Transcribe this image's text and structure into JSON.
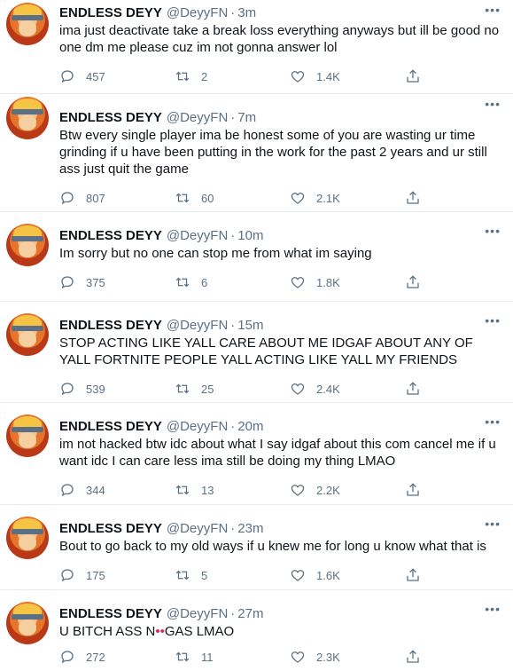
{
  "tweets": [
    {
      "name": "ENDLESS DEYY",
      "handle": "@DeyyFN",
      "time": "3m",
      "text": "ima just deactivate take a break loss everything anyways but ill be good no one dm me please cuz im not gonna answer lol",
      "replies": "457",
      "retweets": "2",
      "likes": "1.4K"
    },
    {
      "name": "ENDLESS DEYY",
      "handle": "@DeyyFN",
      "time": "7m",
      "text": "Btw every single player ima be honest some of you are wasting ur time grinding if u have been putting in the work for the past 2 years and ur still ass just quit the game",
      "replies": "807",
      "retweets": "60",
      "likes": "2.1K"
    },
    {
      "name": "ENDLESS DEYY",
      "handle": "@DeyyFN",
      "time": "10m",
      "text": "Im sorry but no one can stop me from what im saying",
      "replies": "375",
      "retweets": "6",
      "likes": "1.8K"
    },
    {
      "name": "ENDLESS DEYY",
      "handle": "@DeyyFN",
      "time": "15m",
      "text": "STOP ACTING LIKE YALL CARE ABOUT ME IDGAF ABOUT ANY OF YALL FORTNITE PEOPLE YALL ACTING LIKE YALL MY FRIENDS",
      "replies": "539",
      "retweets": "25",
      "likes": "2.4K"
    },
    {
      "name": "ENDLESS DEYY",
      "handle": "@DeyyFN",
      "time": "20m",
      "text": "im not hacked btw idc about what I say idgaf about this com cancel me if u want idc I can care less ima still be doing my thing LMAO",
      "replies": "344",
      "retweets": "13",
      "likes": "2.2K"
    },
    {
      "name": "ENDLESS DEYY",
      "handle": "@DeyyFN",
      "time": "23m",
      "text": "Bout to go back to my old ways if u knew me for long u know what that is",
      "replies": "175",
      "retweets": "5",
      "likes": "1.6K"
    },
    {
      "name": "ENDLESS DEYY",
      "handle": "@DeyyFN",
      "time": "27m",
      "text_before": "U BITCH ASS N",
      "text_censor": "••",
      "text_after": "GAS LMAO",
      "replies": "272",
      "retweets": "11",
      "likes": "2.3K"
    }
  ],
  "separator": "·",
  "more_glyph": "•••",
  "colors": {
    "secondary": "#5b7083",
    "border": "#e6ecf0",
    "censor": "#e0245e"
  }
}
